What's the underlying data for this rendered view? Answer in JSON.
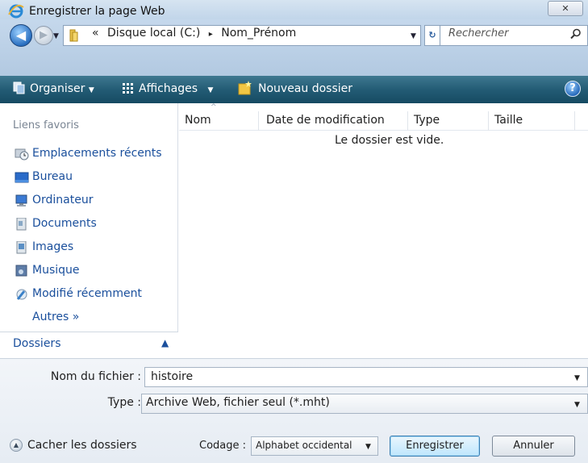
{
  "window": {
    "title": "Enregistrer la page Web",
    "close_glyph": "✕"
  },
  "address": {
    "chevron": "«",
    "crumbs": [
      "Disque local (C:)",
      "Nom_Prénom"
    ],
    "separator": "▸",
    "search_placeholder": "Rechercher"
  },
  "toolbar": {
    "organize_label": "Organiser",
    "views_label": "Affichages",
    "new_folder_label": "Nouveau dossier",
    "help_glyph": "?"
  },
  "sidebar": {
    "favorites_header": "Liens favoris",
    "items": [
      {
        "label": "Emplacements récents",
        "icon": "recent-places-icon"
      },
      {
        "label": "Bureau",
        "icon": "desktop-icon"
      },
      {
        "label": "Ordinateur",
        "icon": "computer-icon"
      },
      {
        "label": "Documents",
        "icon": "documents-icon"
      },
      {
        "label": "Images",
        "icon": "pictures-icon"
      },
      {
        "label": "Musique",
        "icon": "music-icon"
      },
      {
        "label": "Modifié récemment",
        "icon": "recently-changed-icon"
      },
      {
        "label": "Autres »",
        "icon": ""
      }
    ],
    "folders_label": "Dossiers"
  },
  "filelist": {
    "columns": [
      "Nom",
      "Date de modification",
      "Type",
      "Taille"
    ],
    "empty_message": "Le dossier est vide."
  },
  "form": {
    "filename_label": "Nom du fichier :",
    "filename_value": "histoire",
    "type_label": "Type :",
    "type_value": "Archive Web, fichier seul (*.mht)",
    "encoding_label": "Codage :",
    "encoding_value": "Alphabet occidental",
    "hide_folders_label": "Cacher les dossiers",
    "save_label": "Enregistrer",
    "cancel_label": "Annuler"
  },
  "colors": {
    "toolbar_bg": "#235c75",
    "link_blue": "#1a4f9c",
    "title_bar": "#c2d6ea"
  }
}
